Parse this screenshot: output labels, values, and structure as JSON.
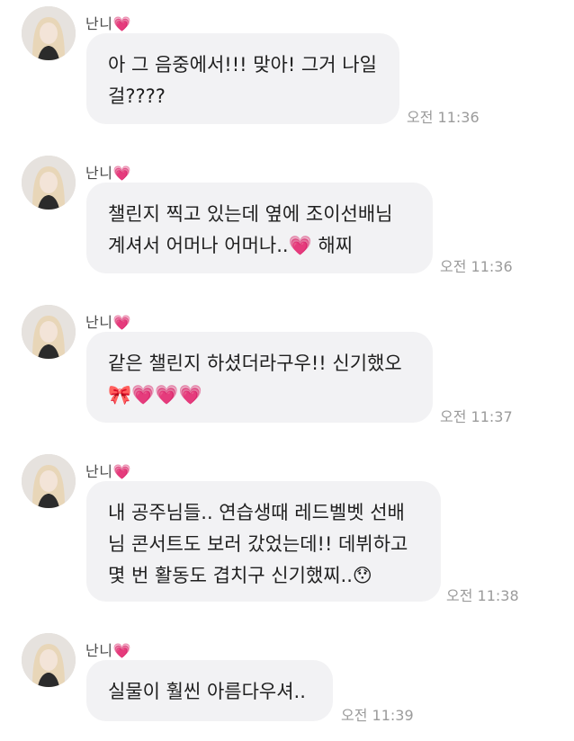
{
  "chat": {
    "messages": [
      {
        "sender": "난니💗",
        "text": "아 그 음중에서!!! 맞아! 그거 나일\n걸????",
        "time": "오전 11:36"
      },
      {
        "sender": "난니💗",
        "text": "챌린지 찍고 있는데 옆에 조이선배님\n계셔서 어머나 어머나..💗 해찌",
        "time": "오전 11:36"
      },
      {
        "sender": "난니💗",
        "text": "같은 챌린지 하셨더라구우!! 신기했오\n🎀💗💗💗",
        "time": "오전 11:37"
      },
      {
        "sender": "난니💗",
        "text": "내 공주님들.. 연습생때 레드벨벳 선배\n님 콘서트도 보러 갔었는데!! 데뷔하고\n몇 번 활동도 겹치구 신기했찌..😯",
        "time": "오전 11:38"
      },
      {
        "sender": "난니💗",
        "text": "실물이 훨씬 아름다우셔..",
        "time": "오전 11:39"
      }
    ]
  }
}
